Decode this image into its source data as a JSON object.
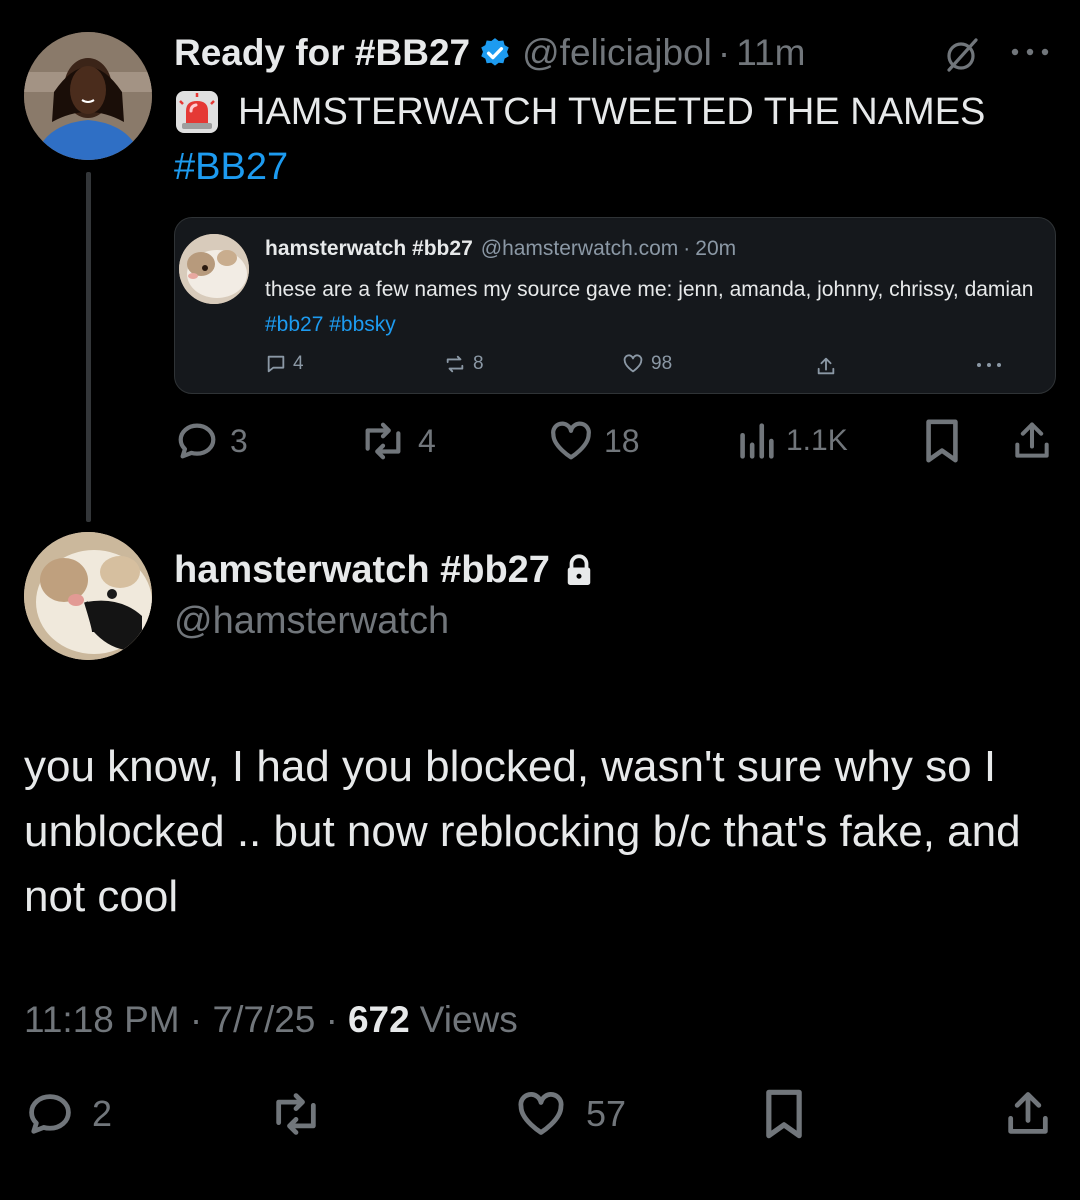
{
  "reply_tweet": {
    "display_name": "Ready for #BB27",
    "handle": "@feliciajbol",
    "separator": "·",
    "time": "11m",
    "text": "HAMSTERWATCH TWEETED THE NAMES",
    "hashtag": "#BB27",
    "actions": {
      "replies": "3",
      "reposts": "4",
      "likes": "18",
      "views": "1.1K"
    },
    "quoted_post": {
      "name": "hamsterwatch #bb27",
      "handle": "@hamsterwatch.com",
      "separator": "·",
      "time": "20m",
      "text": "these are a few names my source gave me: jenn, amanda, johnny, chrissy, damian",
      "tags": [
        "#bb27",
        "#bbsky"
      ],
      "actions": {
        "replies": "4",
        "reposts": "8",
        "likes": "98"
      }
    }
  },
  "main_tweet": {
    "display_name": "hamsterwatch #bb27",
    "handle": "@hamsterwatch",
    "text": "you know, I had you blocked, wasn't sure why so I unblocked .. but now reblocking b/c that's fake, and not cool",
    "timestamp": "11:18 PM · 7/7/25 ·",
    "views_count": "672",
    "views_label": "Views",
    "actions": {
      "replies": "2",
      "likes": "57"
    }
  },
  "colors": {
    "background": "#000000",
    "text": "#e7e9ea",
    "muted": "#71767b",
    "link": "#1d9bf0",
    "card_bg": "#15181c"
  }
}
